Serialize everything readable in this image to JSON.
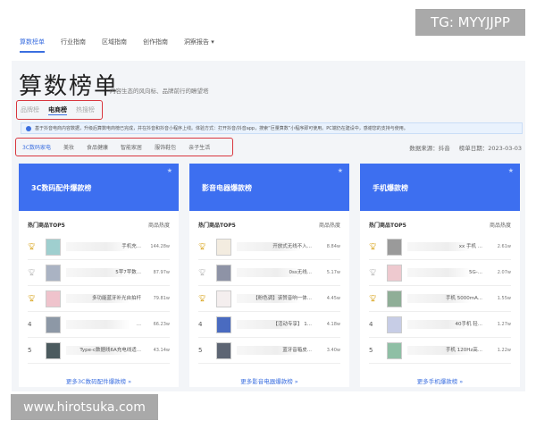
{
  "watermarks": {
    "top": "TG: MYYJJPP",
    "bottom": "www.hirotsuka.com"
  },
  "nav": [
    "算数榜单",
    "行业指南",
    "区域指南",
    "创作指南",
    "洞察报告 ▾"
  ],
  "title": "算数榜单",
  "subtitle": "内容生态的风向标、品牌前行的瞭望塔",
  "tabs": [
    "品牌榜",
    "电商榜",
    "热搜榜"
  ],
  "notice": "基于抖音电商内容数据，升级后算数电商榜已完成，并在抖音和抖音小程序上线。体验方式：打开抖音/抖音app，搜索“巨量算数”小程序即可使用。PC端仍在建设中，感谢您的支持与使用。",
  "categories": [
    "3C数码家电",
    "美妆",
    "食品健康",
    "智能家居",
    "服饰鞋包",
    "亲子生活"
  ],
  "meta": {
    "source": "数据来源：抖音",
    "date": "榜单日期：2023-03-03"
  },
  "cards": [
    {
      "title": "3C数码配件爆款榜",
      "colh": "热门商品TOP5",
      "colv": "商品热度",
      "more": "更多3C数码配件爆款榜 »",
      "rows": [
        {
          "rank": "1",
          "name": "手机充...",
          "value": "144.28w",
          "img": "#9fcfcf"
        },
        {
          "rank": "2",
          "name": "5苹7苹数...",
          "value": "87.97w",
          "img": "#aab3c3"
        },
        {
          "rank": "3",
          "name": "多功能蓝牙补光自拍杆",
          "value": "79.81w",
          "img": "#efc3cc"
        },
        {
          "rank": "4",
          "name": "...",
          "value": "66.23w",
          "img": "#8d98a6"
        },
        {
          "rank": "5",
          "name": "Type-c数据线6A充电线适...",
          "value": "43.14w",
          "img": "#4b5a5e"
        }
      ]
    },
    {
      "title": "影音电器爆款榜",
      "colh": "热门商品TOP5",
      "colv": "商品热度",
      "more": "更多影音电器爆款榜 »",
      "rows": [
        {
          "rank": "1",
          "name": "开放式无线不入...",
          "value": "8.84w",
          "img": "#f3ece0"
        },
        {
          "rank": "2",
          "name": "0ss无线...",
          "value": "5.17w",
          "img": "#8e93a6"
        },
        {
          "rank": "3",
          "name": "【粉色调】该赞音响一体...",
          "value": "4.45w",
          "img": "#f4eeee"
        },
        {
          "rank": "4",
          "name": "【活动专享】 1...",
          "value": "4.18w",
          "img": "#4a6bc0"
        },
        {
          "rank": "5",
          "name": "蓝牙音箱皮...",
          "value": "3.40w",
          "img": "#5d6573"
        }
      ]
    },
    {
      "title": "手机爆款榜",
      "colh": "热门商品TOP5",
      "colv": "商品热度",
      "more": "更多手机爆款榜 »",
      "rows": [
        {
          "rank": "1",
          "name": "xx 手机 ...",
          "value": "2.61w",
          "img": "#9a9a9a"
        },
        {
          "rank": "2",
          "name": "5G-...",
          "value": "2.07w",
          "img": "#eec9cf"
        },
        {
          "rank": "3",
          "name": "手机 5000mA...",
          "value": "1.55w",
          "img": "#8fae97"
        },
        {
          "rank": "4",
          "name": "40手机 轻...",
          "value": "1.27w",
          "img": "#c7cde6"
        },
        {
          "rank": "5",
          "name": "手机 120Hz高...",
          "value": "1.22w",
          "img": "#8fbfa5"
        }
      ]
    }
  ]
}
